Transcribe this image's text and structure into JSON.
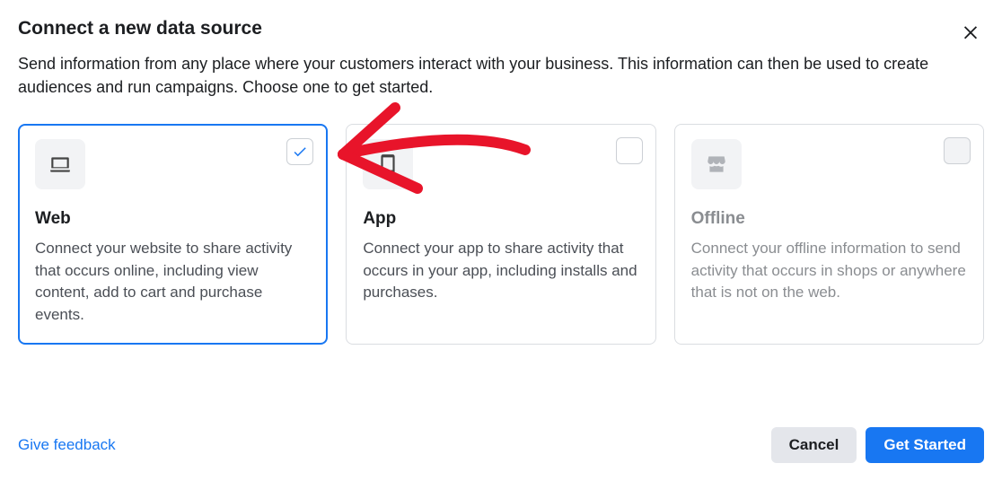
{
  "dialog": {
    "title": "Connect a new data source",
    "subtitle": "Send information from any place where your customers interact with your business. This information can then be used to create audiences and run campaigns. Choose one to get started."
  },
  "options": [
    {
      "id": "web",
      "title": "Web",
      "description": "Connect your website to share activity that occurs online, including view content, add to cart and purchase events.",
      "selected": true,
      "disabled": false,
      "icon": "laptop-icon"
    },
    {
      "id": "app",
      "title": "App",
      "description": "Connect your app to share activity that occurs in your app, including installs and purchases.",
      "selected": false,
      "disabled": false,
      "icon": "mobile-icon"
    },
    {
      "id": "offline",
      "title": "Offline",
      "description": "Connect your offline information to send activity that occurs in shops or anywhere that is not on the web.",
      "selected": false,
      "disabled": true,
      "icon": "store-icon"
    }
  ],
  "footer": {
    "feedback_label": "Give feedback",
    "cancel_label": "Cancel",
    "primary_label": "Get Started"
  }
}
